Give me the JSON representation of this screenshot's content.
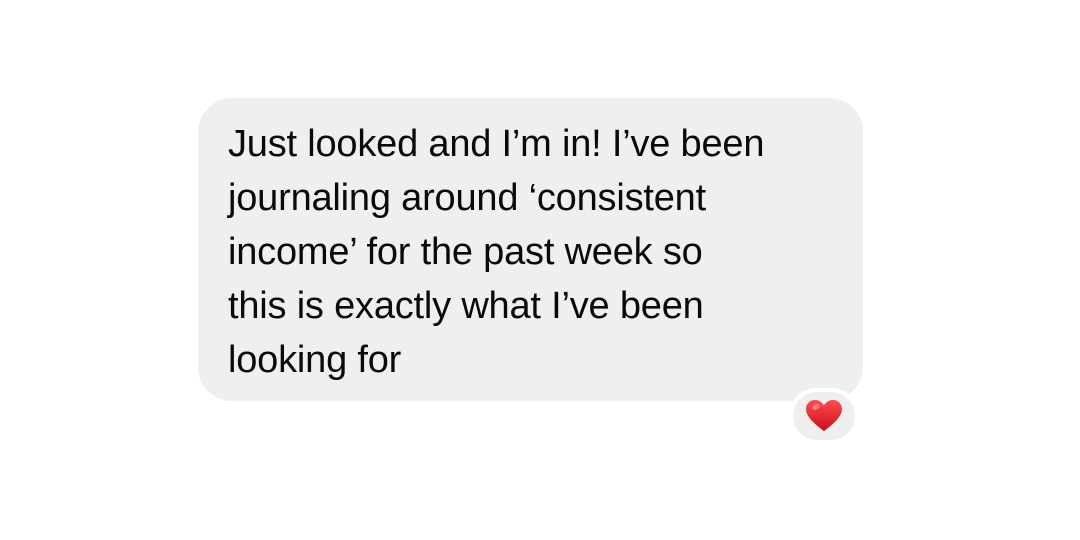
{
  "message": {
    "lines": [
      "Just looked and I’m in! I’ve been",
      "journaling around ‘consistent",
      "income’ for the past week so",
      "this is exactly what I’ve been",
      "looking for"
    ],
    "bubble_color": "#efefef",
    "text_color": "#0a0a0a"
  },
  "reaction": {
    "icon": "red-heart-icon",
    "color": "#e0272e"
  }
}
